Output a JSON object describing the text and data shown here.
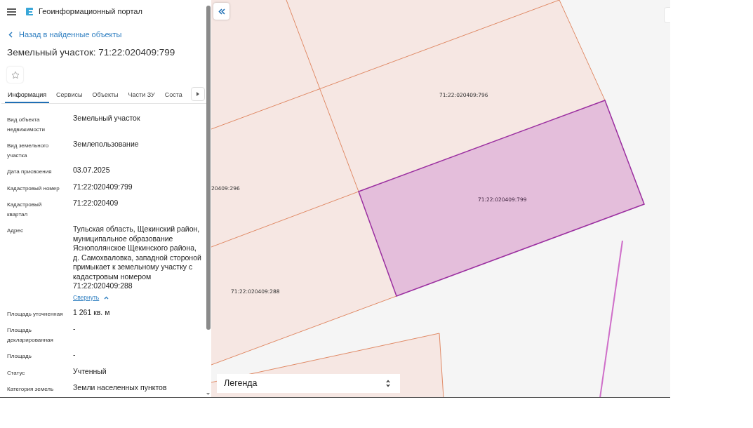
{
  "header": {
    "title": "Геоинформационный портал"
  },
  "back_link": "Назад в найденные объекты",
  "heading": "Земельный участок: 71:22:020409:799",
  "favorite": {
    "on": false
  },
  "tabs": [
    {
      "label": "Информация",
      "selected": true
    },
    {
      "label": "Сервисы",
      "selected": false
    },
    {
      "label": "Объекты",
      "selected": false
    },
    {
      "label": "Части ЗУ",
      "selected": false
    },
    {
      "label": "Соста",
      "selected": false
    }
  ],
  "fields": [
    {
      "label": "Вид объекта недвижимости",
      "value": "Земельный участок"
    },
    {
      "label": "Вид земельного участка",
      "value": "Землепользование"
    },
    {
      "label": "Дата присвоения",
      "value": "03.07.2025"
    },
    {
      "label": "Кадастровый номер",
      "value": "71:22:020409:799"
    },
    {
      "label": "Кадастровый квартал",
      "value": "71:22:020409"
    },
    {
      "label": "Адрес",
      "value": "Тульская область, Щекинский район, муниципальное образование Яснополянское Щекинского района, д. Самохваловка, западной стороной примыкает к земельному участку с кадастровым номером 71:22:020409:288",
      "toggle": "Свернуть"
    },
    {
      "label": "Площадь уточненная",
      "value": "1 261 кв. м"
    },
    {
      "label": "Площадь декларированная",
      "value": "-"
    },
    {
      "label": "Площадь",
      "value": "-"
    },
    {
      "label": "Статус",
      "value": "Учтенный"
    },
    {
      "label": "Категория земель",
      "value": "Земли населенных пунктов"
    }
  ],
  "map": {
    "parcel_labels": [
      {
        "text": "71:22:020409:796",
        "selected": false
      },
      {
        "text": "20409:296",
        "selected": false
      },
      {
        "text": "71:22:020409:799",
        "selected": true
      },
      {
        "text": "71:22:020409:288",
        "selected": false
      }
    ],
    "legend": "Легенда"
  }
}
